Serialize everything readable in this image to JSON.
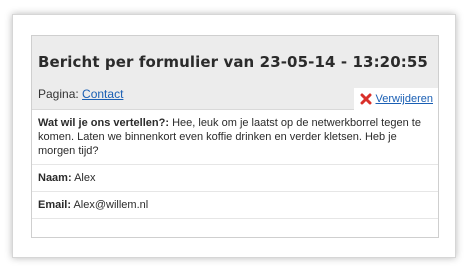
{
  "header": {
    "title": "Bericht per formulier van 23-05-14 - 13:20:55",
    "page_label": "Pagina",
    "page_link": "Contact",
    "delete_label": "Verwijderen"
  },
  "fields": [
    {
      "label": "Wat wil je ons vertellen?:",
      "value": "Hee, leuk om je laatst op de netwerkborrel tegen te komen. Laten we binnenkort even koffie drinken en verder kletsen. Heb je morgen tijd?"
    },
    {
      "label": "Naam:",
      "value": "Alex"
    },
    {
      "label": "Email:",
      "value": "Alex@willem.nl"
    }
  ],
  "icons": {
    "delete": "close-x-icon"
  },
  "colors": {
    "link": "#1a5fb4",
    "delete_icon": "#d9302a",
    "header_bg": "#ececec"
  }
}
